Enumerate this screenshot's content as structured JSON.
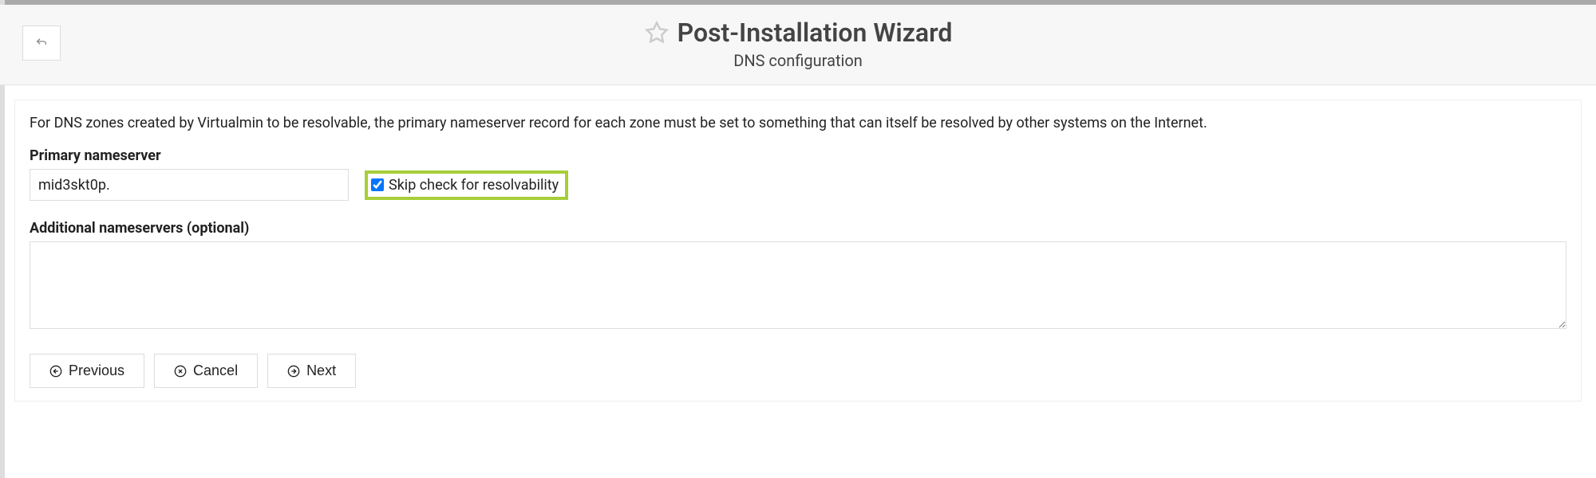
{
  "header": {
    "title": "Post-Installation Wizard",
    "subtitle": "DNS configuration"
  },
  "content": {
    "description": "For DNS zones created by Virtualmin to be resolvable, the primary nameserver record for each zone must be set to something that can itself be resolved by other systems on the Internet.",
    "primary_label": "Primary nameserver",
    "primary_value": "mid3skt0p.",
    "skip_check_label": "Skip check for resolvability",
    "skip_check_checked": true,
    "additional_label": "Additional nameservers (optional)",
    "additional_value": ""
  },
  "buttons": {
    "previous": "Previous",
    "cancel": "Cancel",
    "next": "Next"
  }
}
